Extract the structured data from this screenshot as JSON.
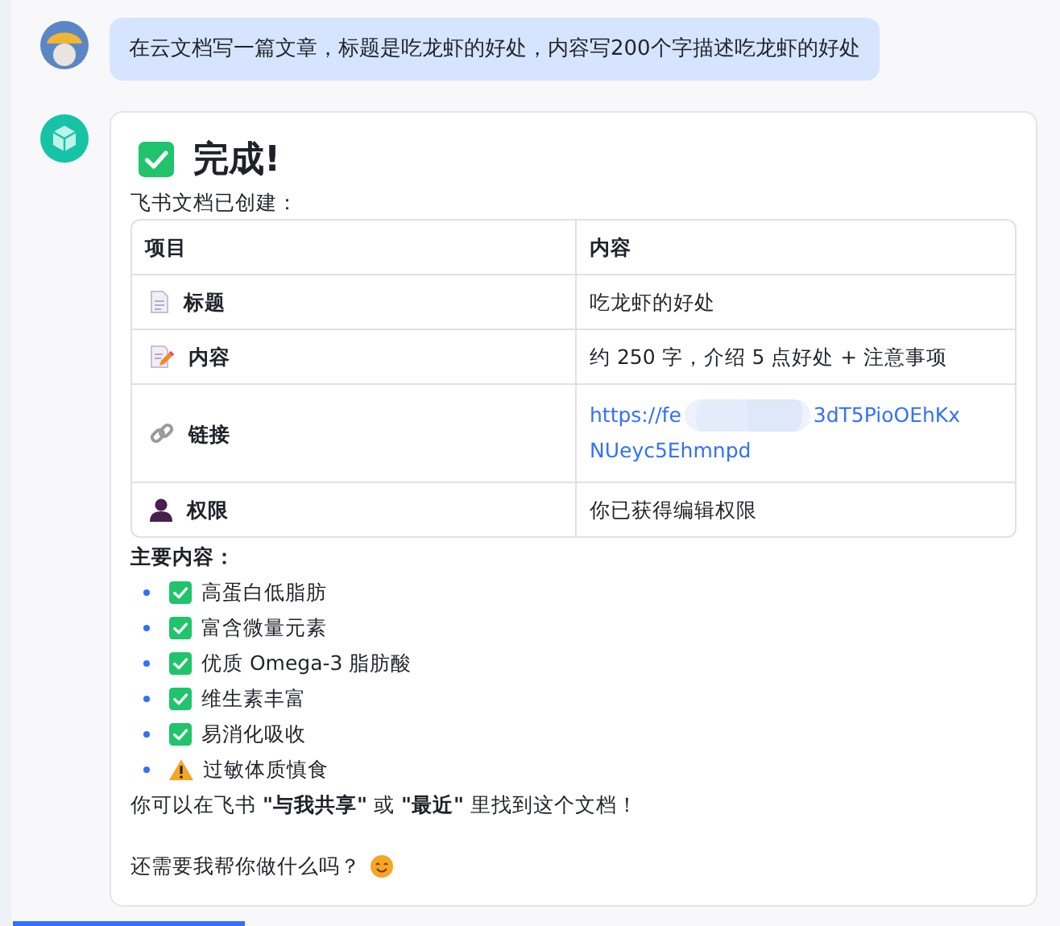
{
  "user_message": {
    "text": "在云文档写一篇文章，标题是吃龙虾的好处，内容写200个字描述吃龙虾的好处"
  },
  "reply": {
    "title": "完成!",
    "intro": "飞书文档已创建：",
    "table": {
      "columns": [
        "项目",
        "内容"
      ],
      "rows": [
        {
          "kind": "doc",
          "label": "标题",
          "value": "吃龙虾的好处"
        },
        {
          "kind": "edit",
          "label": "内容",
          "value": "约 250 字，介绍 5 点好处 + 注意事项"
        },
        {
          "kind": "link",
          "label": "链接",
          "link_start": "https://fe",
          "link_end": "3dT5PioOEhKx",
          "link_line_2": "NUeyc5Ehmnpd"
        },
        {
          "kind": "person",
          "label": "权限",
          "value": "你已获得编辑权限"
        }
      ]
    },
    "list_title": "主要内容：",
    "items": [
      {
        "kind": "check",
        "text": "高蛋白低脂肪"
      },
      {
        "kind": "check",
        "text": "富含微量元素"
      },
      {
        "kind": "check",
        "text": "优质 Omega-3 脂肪酸"
      },
      {
        "kind": "check",
        "text": "维生素丰富"
      },
      {
        "kind": "check",
        "text": "易消化吸收"
      },
      {
        "kind": "warning",
        "text": "过敏体质慎食"
      }
    ],
    "note": "你可以在飞书 **\"与我共享\"** 或 **\"最近\"** 里找到这个文档！",
    "closing": "还需要我帮你做什么吗？"
  }
}
